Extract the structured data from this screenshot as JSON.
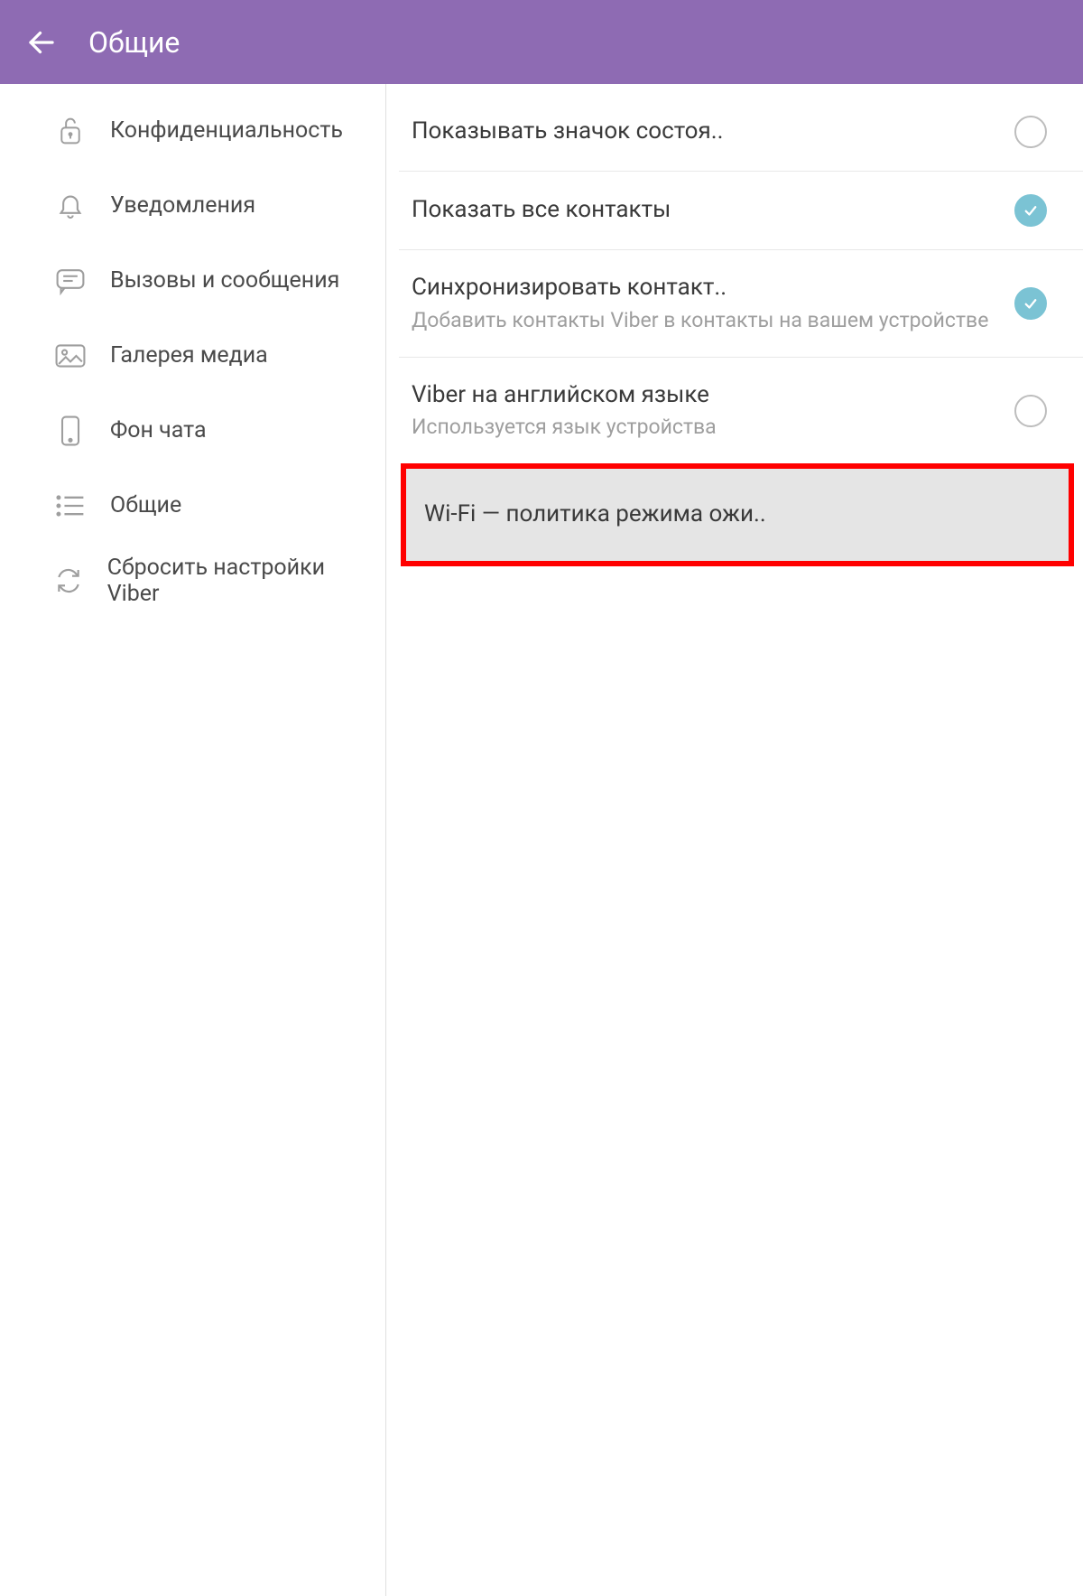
{
  "header": {
    "title": "Общие"
  },
  "sidebar": {
    "items": [
      {
        "label": "Конфиденциальность",
        "icon": "lock"
      },
      {
        "label": "Уведомления",
        "icon": "bell"
      },
      {
        "label": "Вызовы и сообщения",
        "icon": "message"
      },
      {
        "label": "Галерея медиа",
        "icon": "image"
      },
      {
        "label": "Фон чата",
        "icon": "phone"
      },
      {
        "label": "Общие",
        "icon": "list"
      },
      {
        "label": "Сбросить настройки Viber",
        "icon": "refresh"
      }
    ]
  },
  "settings": [
    {
      "title": "Показывать значок состоя..",
      "subtitle": "",
      "checked": false
    },
    {
      "title": "Показать все контакты",
      "subtitle": "",
      "checked": true
    },
    {
      "title": "Синхронизировать контакт..",
      "subtitle": "Добавить контакты Viber в контакты на вашем устройстве",
      "checked": true
    },
    {
      "title": "Viber на английском языке",
      "subtitle": "Используется язык устройства",
      "checked": false
    }
  ],
  "highlighted": {
    "title": "Wi-Fi — политика режима ожи.."
  }
}
